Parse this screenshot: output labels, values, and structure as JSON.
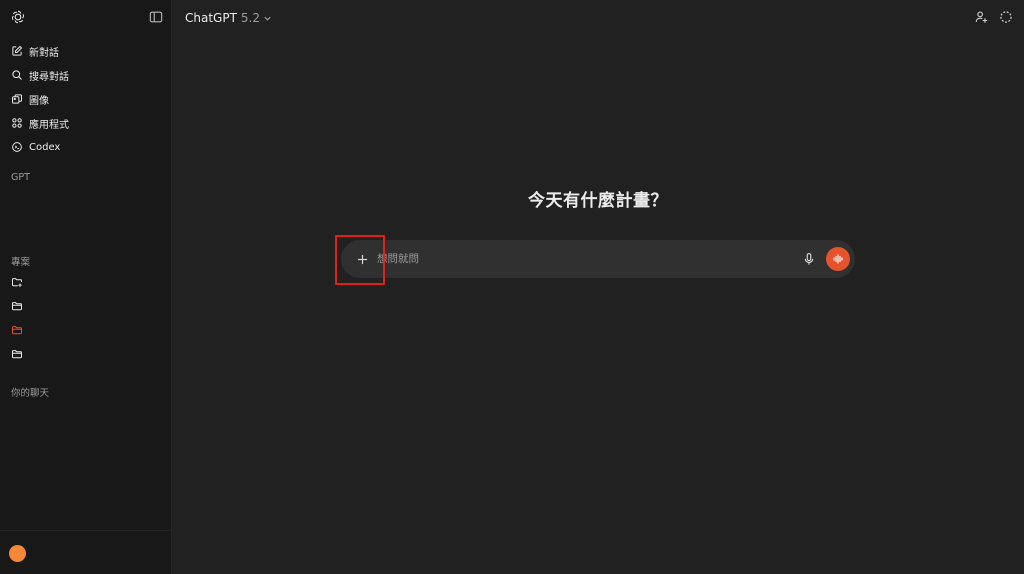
{
  "sidebar": {
    "logo_icon": "openai-logo-icon",
    "toggle_icon": "sidebar-toggle-icon",
    "nav": [
      {
        "label": "新對話",
        "icon": "pencil-square-icon"
      },
      {
        "label": "搜尋對話",
        "icon": "search-icon"
      },
      {
        "label": "圖像",
        "icon": "images-icon"
      },
      {
        "label": "應用程式",
        "icon": "apps-grid-icon"
      },
      {
        "label": "Codex",
        "icon": "codex-icon"
      }
    ],
    "gpt_label": "GPT",
    "projects_label": "專案",
    "projects_icons": [
      "new-folder-icon",
      "folder-icon",
      "folder-icon-active",
      "folder-icon"
    ],
    "chats_label": "你的聊天",
    "accent_color": "#e5532d",
    "avatar_color": "#f6883a"
  },
  "header": {
    "model_name": "ChatGPT",
    "model_version": "5.2",
    "right_icons": [
      "add-person-icon",
      "temporary-chat-icon"
    ]
  },
  "main": {
    "greeting": "今天有什麼計畫？",
    "composer": {
      "placeholder": "想問就問",
      "value": "",
      "plus_icon": "plus-icon",
      "mic_icon": "microphone-icon",
      "voice_icon": "voice-waveform-icon",
      "voice_color": "#e5532d"
    },
    "highlight_color": "#e0201b"
  }
}
